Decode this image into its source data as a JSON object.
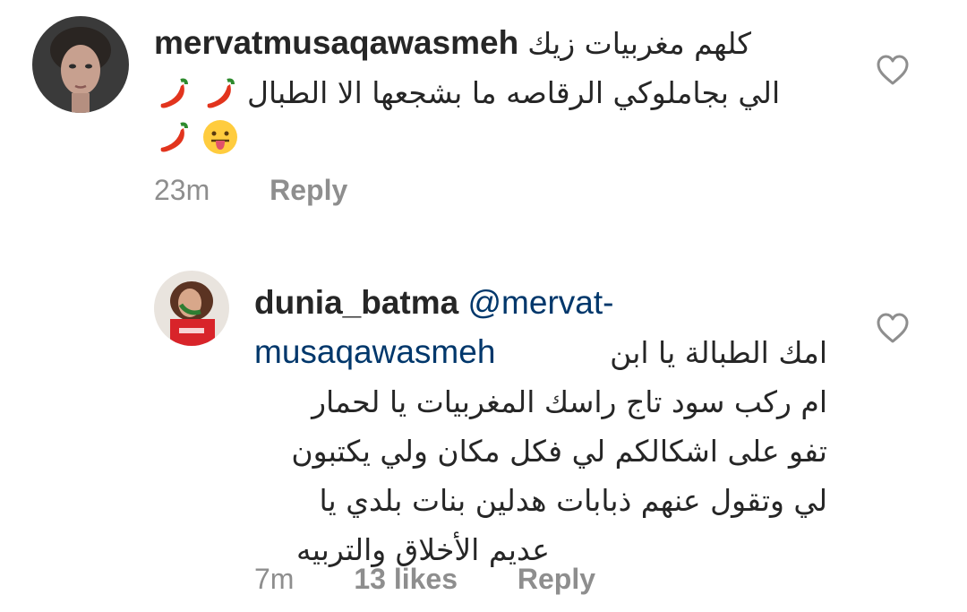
{
  "comments": [
    {
      "username": "mervatmusaqawasmeh",
      "lines": [
        "كلهم مغربيات زيك",
        "الي بجاملوكي الرقاصه ما بشجعها الا الطبال",
        ""
      ],
      "time": "23m",
      "reply_label": "Reply",
      "icons": [
        "hot-pepper-emoji",
        "hot-pepper-emoji",
        "hot-pepper-emoji",
        "face-with-tongue-emoji"
      ]
    },
    {
      "username": "dunia_batma",
      "mention_line1": "@mervat-",
      "mention_line2": "musaqawasmeh",
      "lines": [
        "امك الطبالة يا ابن",
        "ام ركب سود تاج راسك المغربيات يا لحمار",
        "تفو على اشكالكم لي فكل مكان ولي يكتبون",
        "لي وتقول عنهم ذبابات هدلين بنات بلدي يا",
        "عديم الأخلاق والتربيه"
      ],
      "time": "7m",
      "likes": "13 likes",
      "reply_label": "Reply"
    }
  ],
  "colors": {
    "text": "#262626",
    "meta": "#8e8e8e",
    "mention": "#00376b"
  }
}
